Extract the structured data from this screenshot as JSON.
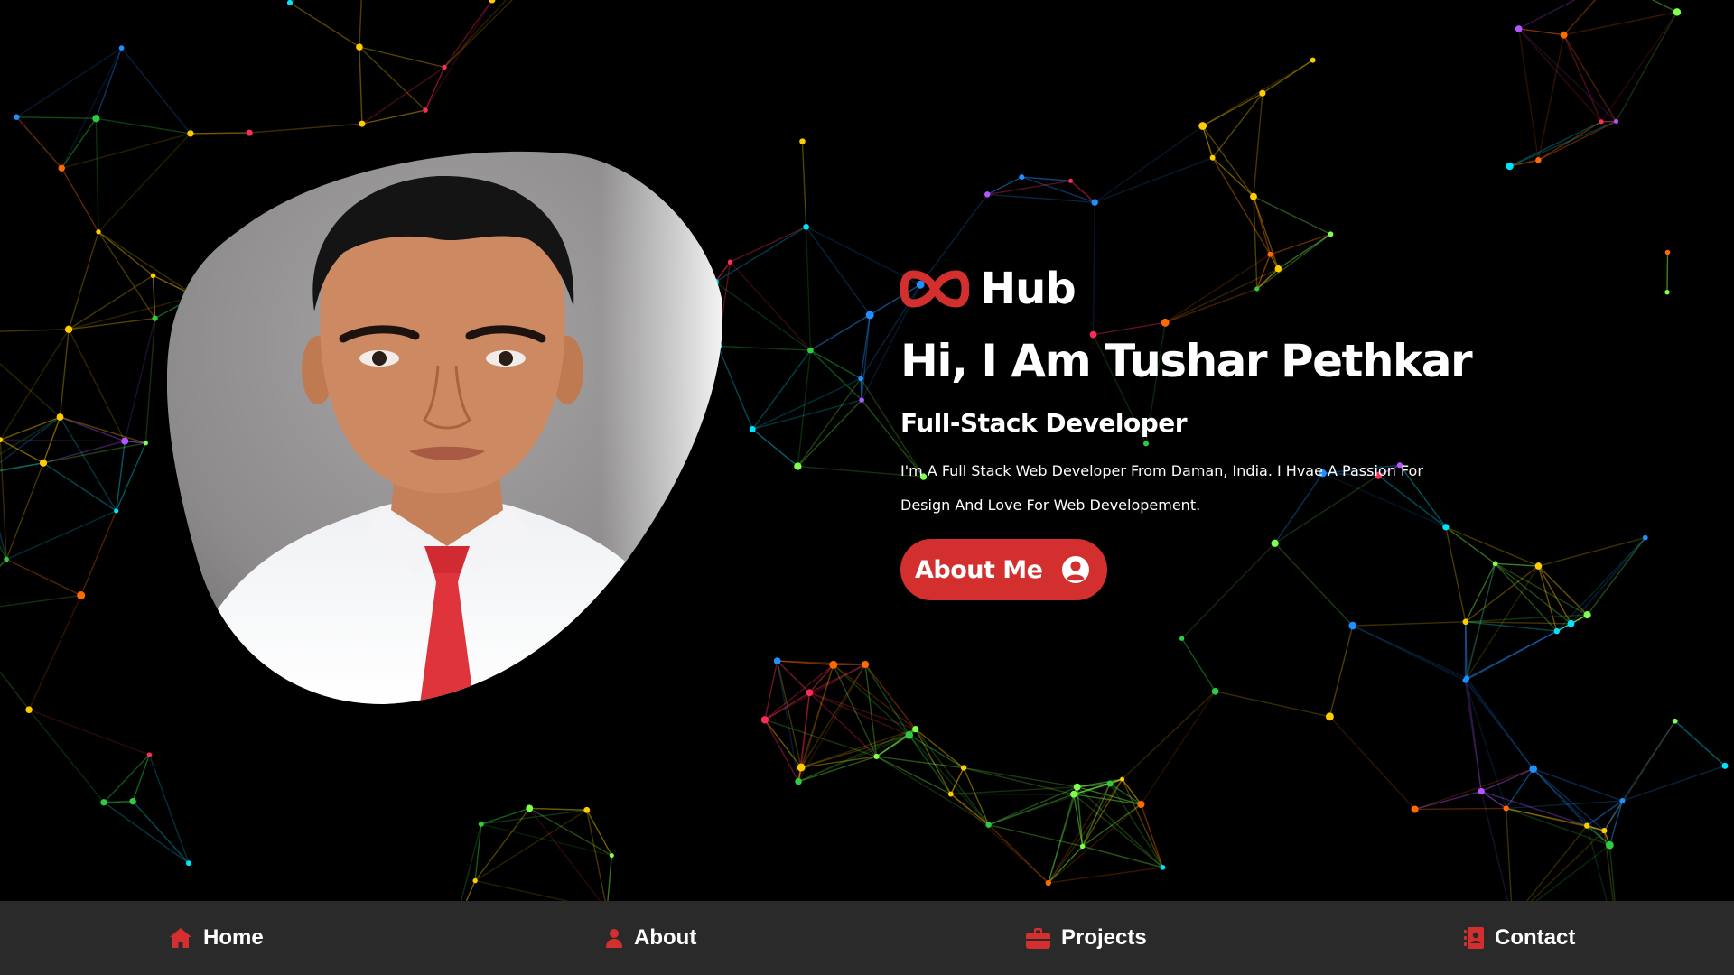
{
  "brand": {
    "name": "Hub",
    "logo_icon": "infinity-icon",
    "accent": "#d32f2f"
  },
  "hero": {
    "headline": "Hi, I Am Tushar Pethkar",
    "subtitle": "Full-Stack Developer",
    "intro": "I'm A Full Stack Web Developer From Daman, India. I Hvae A Passion For Design And Love For Web Developement.",
    "button_label": "About Me",
    "button_icon": "user-circle-icon",
    "photo": "profile-photo"
  },
  "nav": {
    "background": "#2a2a2a",
    "items": [
      {
        "label": "Home",
        "icon": "house-icon"
      },
      {
        "label": "About",
        "icon": "user-icon"
      },
      {
        "label": "Projects",
        "icon": "briefcase-icon"
      },
      {
        "label": "Contact",
        "icon": "address-book-icon"
      }
    ]
  }
}
